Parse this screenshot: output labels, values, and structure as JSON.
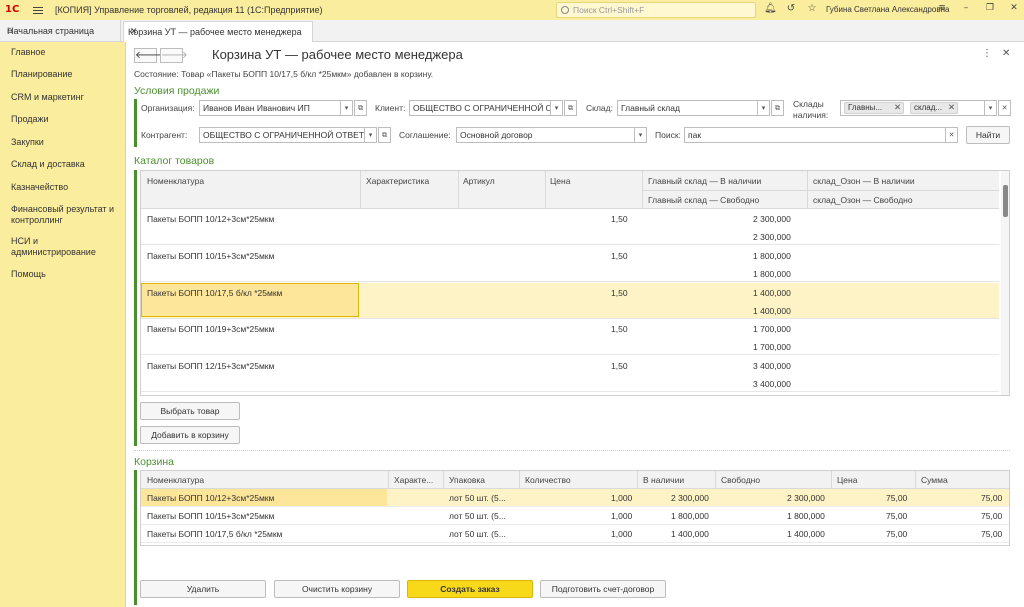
{
  "titlebar": {
    "logo": "1С",
    "title": "[КОПИЯ] Управление торговлей, редакция 11  (1С:Предприятие)",
    "search_placeholder": "Поиск Ctrl+Shift+F",
    "user": "Губина Светлана Александровна"
  },
  "tabs": {
    "home": "Начальная страница",
    "active": "Корзина УТ — рабочее место менеджера"
  },
  "sidebar": {
    "items": [
      "Главное",
      "Планирование",
      "CRM и маркетинг",
      "Продажи",
      "Закупки",
      "Склад и доставка",
      "Казначейство",
      "Финансовый результат и контроллинг",
      "НСИ и администрирование",
      "Помощь"
    ]
  },
  "form": {
    "title": "Корзина УТ — рабочее место менеджера",
    "status": "Состояние: Товар «Пакеты БОПП 10/17,5 б/кл *25мкм» добавлен в корзину."
  },
  "conditions": {
    "section": "Условия продажи",
    "org_label": "Организация:",
    "org_value": "Иванов Иван Иванович ИП",
    "client_label": "Клиент:",
    "client_value": "ОБЩЕСТВО С ОГРАНИЧЕННОЙ О",
    "warehouse_label": "Склад:",
    "warehouse_value": "Главный склад",
    "warehouses_label_1": "Склады",
    "warehouses_label_2": "наличия:",
    "warehouse_chips": [
      "Главны...",
      "склад..."
    ],
    "contractor_label": "Контрагент:",
    "contractor_value": "ОБЩЕСТВО С ОГРАНИЧЕННОЙ ОТВЕТ",
    "agreement_label": "Соглашение:",
    "agreement_value": "Основной договор",
    "search_label": "Поиск:",
    "search_value": "пак",
    "find_button": "Найти"
  },
  "catalog": {
    "section": "Каталог товаров",
    "headers": {
      "name": "Номенклатура",
      "char": "Характеристика",
      "article": "Артикул",
      "price": "Цена",
      "main_avail": "Главный склад — В наличии",
      "main_free": "Главный склад — Свободно",
      "ozon_avail": "склад_Озон — В наличии",
      "ozon_free": "склад_Озон — Свободно"
    },
    "rows": [
      {
        "name": "Пакеты БОПП 10/12+3см*25мкм",
        "price": "1,50",
        "avail": "2 300,000",
        "free": "2 300,000"
      },
      {
        "name": "Пакеты БОПП 10/15+3см*25мкм",
        "price": "1,50",
        "avail": "1 800,000",
        "free": "1 800,000"
      },
      {
        "name": "Пакеты БОПП 10/17,5 б/кл *25мкм",
        "price": "1,50",
        "avail": "1 400,000",
        "free": "1 400,000"
      },
      {
        "name": "Пакеты БОПП 10/19+3см*25мкм",
        "price": "1,50",
        "avail": "1 700,000",
        "free": "1 700,000"
      },
      {
        "name": "Пакеты БОПП 12/15+3см*25мкм",
        "price": "1,50",
        "avail": "3 400,000",
        "free": "3 400,000"
      }
    ],
    "select_button": "Выбрать товар",
    "add_button": "Добавить в корзину"
  },
  "basket": {
    "section": "Корзина",
    "headers": [
      "Номенклатура",
      "Характе...",
      "Упаковка",
      "Количество",
      "В наличии",
      "Свободно",
      "Цена",
      "Сумма"
    ],
    "rows": [
      {
        "name": "Пакеты БОПП 10/12+3см*25мкм",
        "pack": "лот 50 шт. (5...",
        "qty": "1,000",
        "avail": "2 300,000",
        "free": "2 300,000",
        "price": "75,00",
        "sum": "75,00"
      },
      {
        "name": "Пакеты БОПП 10/15+3см*25мкм",
        "pack": "лот 50 шт. (5...",
        "qty": "1,000",
        "avail": "1 800,000",
        "free": "1 800,000",
        "price": "75,00",
        "sum": "75,00"
      },
      {
        "name": "Пакеты БОПП 10/17,5 б/кл *25мкм",
        "pack": "лот 50 шт. (5...",
        "qty": "1,000",
        "avail": "1 400,000",
        "free": "1 400,000",
        "price": "75,00",
        "sum": "75,00"
      }
    ]
  },
  "actions": {
    "delete": "Удалить",
    "clear": "Очистить корзину",
    "create_order": "Создать заказ",
    "prepare_invoice": "Подготовить счет-договор"
  }
}
